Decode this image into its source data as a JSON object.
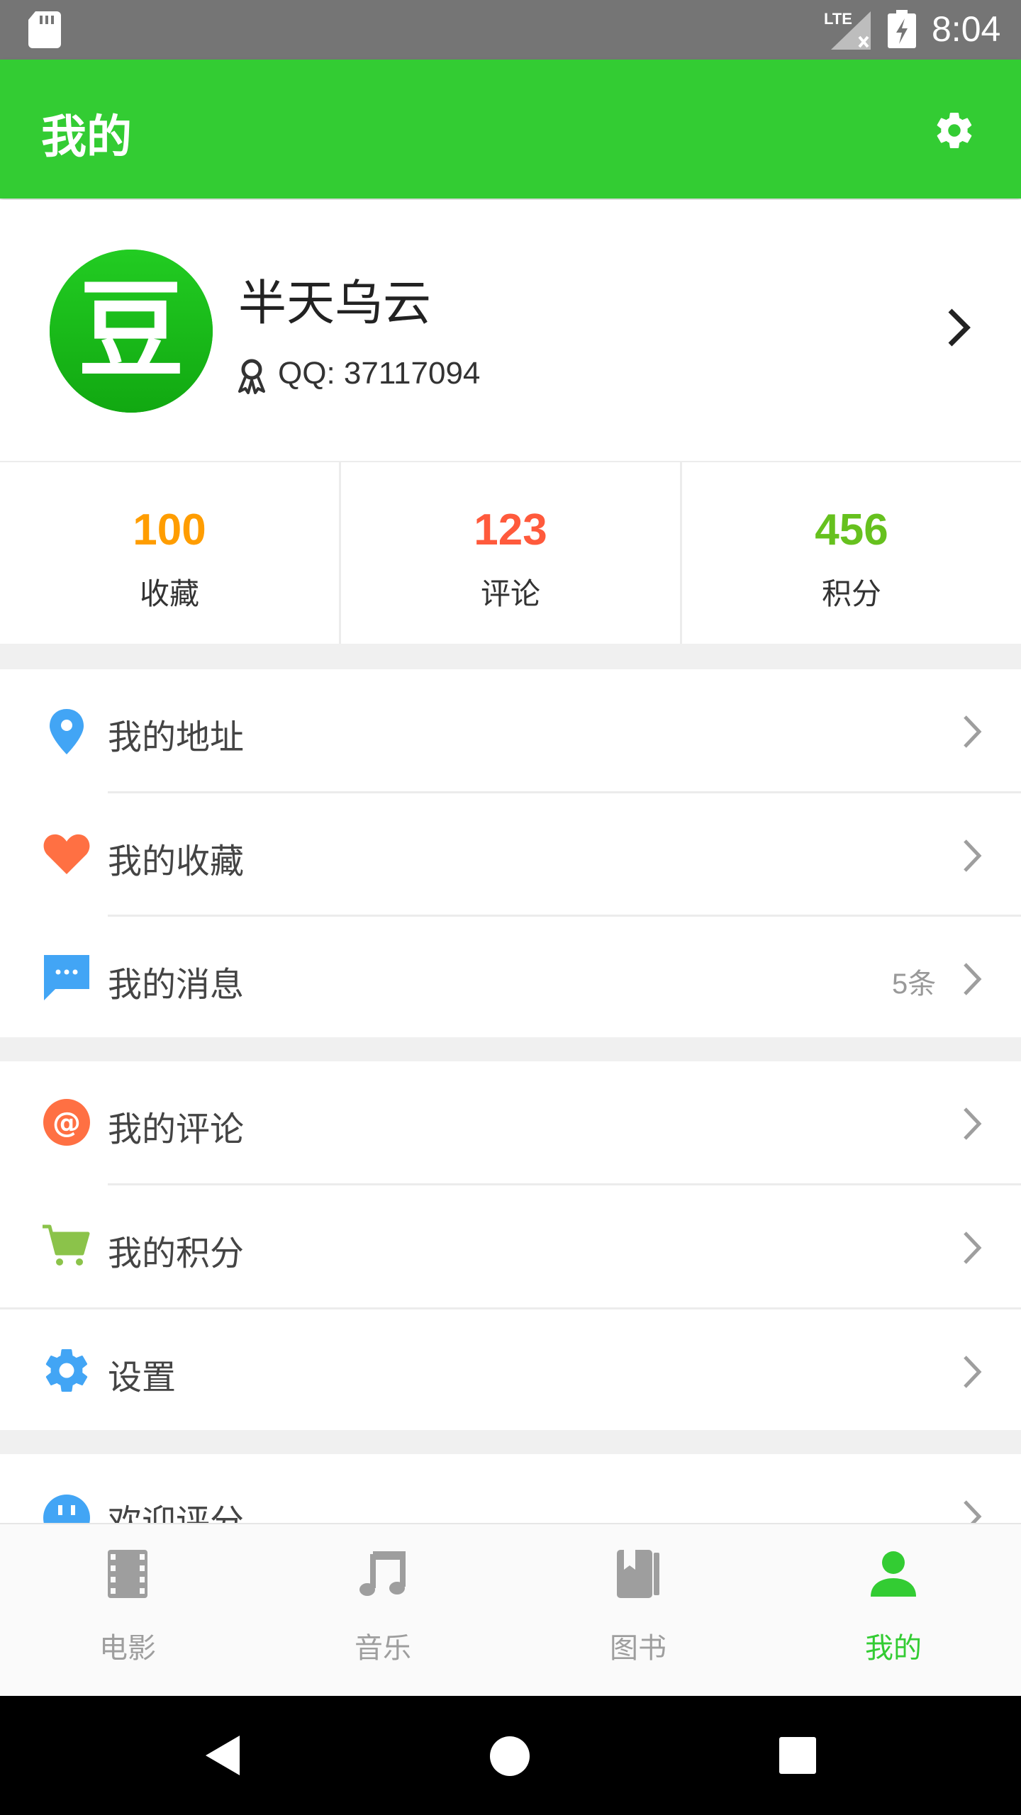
{
  "status_bar": {
    "network": "LTE",
    "time": "8:04"
  },
  "app_bar": {
    "title": "我的",
    "settings_icon": "gear-icon"
  },
  "profile": {
    "avatar_char": "豆",
    "name": "半天乌云",
    "qq": "QQ: 37117094"
  },
  "stats": [
    {
      "value": "100",
      "label": "收藏",
      "color": "#ff9d00"
    },
    {
      "value": "123",
      "label": "评论",
      "color": "#ff5a3c"
    },
    {
      "value": "456",
      "label": "积分",
      "color": "#66c11e"
    }
  ],
  "menu_group_1": [
    {
      "label": "我的地址",
      "icon": "location-pin-icon",
      "icon_color": "#42a5f5"
    },
    {
      "label": "我的收藏",
      "icon": "heart-icon",
      "icon_color": "#ff7043"
    },
    {
      "label": "我的消息",
      "icon": "message-icon",
      "icon_color": "#42a5f5",
      "badge": "5条"
    }
  ],
  "menu_group_2": [
    {
      "label": "我的评论",
      "icon": "at-icon",
      "icon_color": "#ff7043"
    },
    {
      "label": "我的积分",
      "icon": "cart-icon",
      "icon_color": "#8bc34a"
    },
    {
      "label": "设置",
      "icon": "gear-icon",
      "icon_color": "#42a5f5"
    }
  ],
  "menu_group_3": [
    {
      "label": "欢迎评分",
      "icon": "rate-icon",
      "icon_color": "#42a5f5"
    }
  ],
  "bottom_nav": [
    {
      "label": "电影",
      "icon": "film-icon",
      "active": false
    },
    {
      "label": "音乐",
      "icon": "music-icon",
      "active": false
    },
    {
      "label": "图书",
      "icon": "book-icon",
      "active": false
    },
    {
      "label": "我的",
      "icon": "person-icon",
      "active": true
    }
  ],
  "colors": {
    "brand_green": "#33cc33",
    "status_bar": "#757575"
  }
}
